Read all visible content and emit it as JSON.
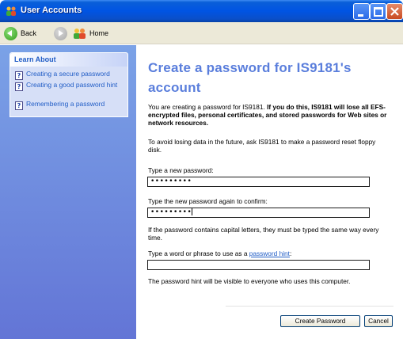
{
  "window": {
    "title": "User Accounts",
    "accent": "#0054E3",
    "controls": [
      "minimize-icon",
      "maximize-icon",
      "close-icon"
    ]
  },
  "toolbar": {
    "back_label": "Back",
    "home_label": "Home"
  },
  "sidebar": {
    "section_title": "Learn About",
    "items": [
      {
        "label": "Creating a secure password",
        "icon": "help-icon"
      },
      {
        "label": "Creating a good password hint",
        "icon": "help-icon"
      },
      {
        "label": "Remembering a password",
        "icon": "help-icon"
      }
    ]
  },
  "main": {
    "heading": "Create a password for IS9181's account",
    "intro_plain": "You are creating a password for IS9181. ",
    "intro_bold": "If you do this, IS9181 will lose all EFS-encrypted files, personal certificates, and stored passwords for Web sites or network resources.",
    "reset_note": "To avoid losing data in the future, ask IS9181 to make a password reset floppy disk.",
    "new_password_label": "Type a new password:",
    "new_password_value": "•••••••••",
    "confirm_label": "Type the new password again to confirm:",
    "confirm_value": "•••••••••",
    "caps_note": "If the password contains capital letters, they must be typed the same way every time.",
    "hint_label_prefix": "Type a word or phrase to use as a ",
    "hint_link": "password hint",
    "hint_label_suffix": ":",
    "hint_value": "",
    "hint_visibility_note": "The password hint will be visible to everyone who uses this computer.",
    "create_button": "Create Password",
    "cancel_button": "Cancel"
  }
}
